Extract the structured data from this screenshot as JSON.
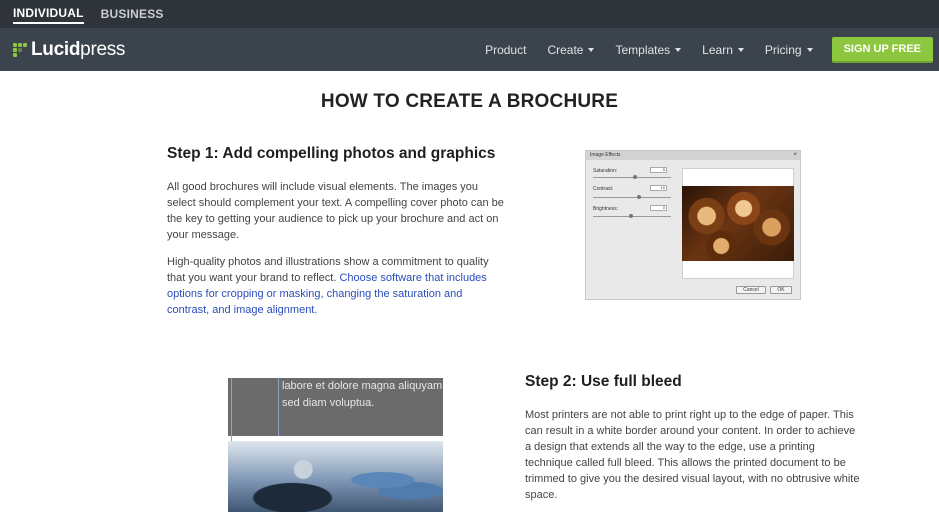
{
  "topbar": {
    "segments": [
      {
        "label": "INDIVIDUAL",
        "active": true
      },
      {
        "label": "BUSINESS",
        "active": false
      }
    ]
  },
  "nav": {
    "logo": {
      "bold": "Lucid",
      "light": "press",
      "icon": "lucidpress-logo-icon",
      "accent": "#8dc63f"
    },
    "items": [
      {
        "label": "Product",
        "dropdown": false
      },
      {
        "label": "Create",
        "dropdown": true
      },
      {
        "label": "Templates",
        "dropdown": true
      },
      {
        "label": "Learn",
        "dropdown": true
      },
      {
        "label": "Pricing",
        "dropdown": true
      }
    ],
    "cta": "SIGN UP FREE"
  },
  "page": {
    "title": "HOW TO CREATE A BROCHURE",
    "step1": {
      "heading": "Step 1: Add compelling photos and graphics",
      "p1": "All good brochures will include visual elements. The images you select should complement your text. A compelling cover photo can be the key to getting your audience to pick up your brochure and act on your message.",
      "p2_text": "High-quality photos and illustrations show a commitment to quality that you want your brand to reflect.",
      "p2_link": "Choose software that includes options for cropping or masking, changing the saturation and contrast, and image alignment."
    },
    "step2": {
      "heading": "Step 2: Use full bleed",
      "p1": "Most printers are not able to print right up to the edge of paper. This can result in a white border around your content. In order to achieve a design that extends all the way to the edge, use a printing technique called full bleed. This allows the printed document to be trimmed to give you the desired visual layout, with no obtrusive white space."
    }
  },
  "dialog": {
    "title": "Image Effects",
    "close": "×",
    "rows": [
      {
        "label": "Saturation:",
        "value": "5",
        "level": 0.55
      },
      {
        "label": "Contrast:",
        "value": "10",
        "level": 0.6
      },
      {
        "label": "Brightness:",
        "value": "0",
        "level": 0.5
      }
    ],
    "cancel": "Cancel",
    "ok": "OK"
  },
  "bleed_sample": {
    "line1": "labore et dolore magna aliquyam e",
    "line2": "sed diam voluptua."
  }
}
